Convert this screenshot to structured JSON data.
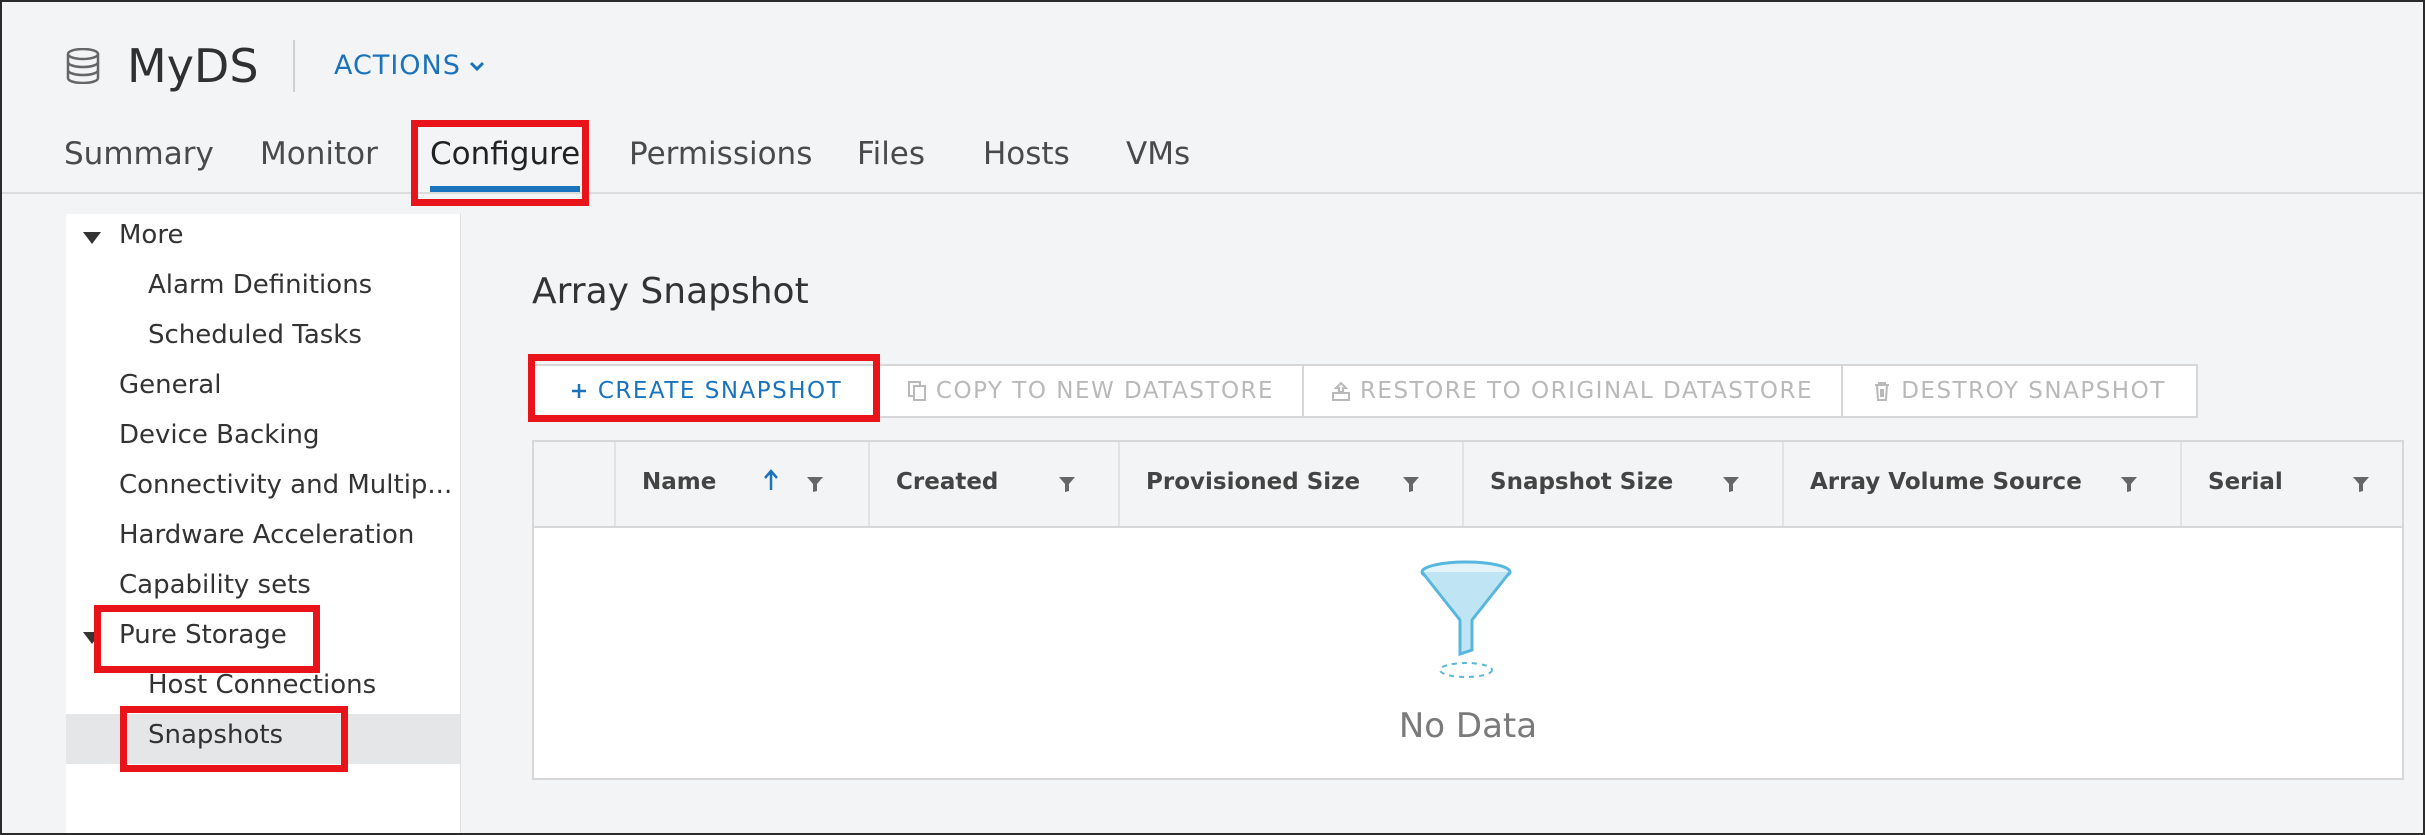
{
  "header": {
    "object_icon": "datastore-icon",
    "title": "MyDS",
    "actions_label": "ACTIONS",
    "actions_icon": "chevron-down-icon"
  },
  "tabs": [
    {
      "label": "Summary"
    },
    {
      "label": "Monitor"
    },
    {
      "label": "Configure",
      "active": true
    },
    {
      "label": "Permissions"
    },
    {
      "label": "Files"
    },
    {
      "label": "Hosts"
    },
    {
      "label": "VMs"
    }
  ],
  "sidebar": {
    "items": [
      {
        "label": "More",
        "expanded": true
      },
      {
        "label": "Alarm Definitions"
      },
      {
        "label": "Scheduled Tasks"
      },
      {
        "label": "General"
      },
      {
        "label": "Device Backing"
      },
      {
        "label": "Connectivity and Multip..."
      },
      {
        "label": "Hardware Acceleration"
      },
      {
        "label": "Capability sets"
      },
      {
        "label": "Pure Storage",
        "expanded": true
      },
      {
        "label": "Host Connections"
      },
      {
        "label": "Snapshots",
        "selected": true
      }
    ]
  },
  "main": {
    "title": "Array Snapshot",
    "toolbar": [
      {
        "label": "CREATE SNAPSHOT",
        "icon": "plus-icon",
        "enabled": true
      },
      {
        "label": "COPY TO NEW DATASTORE",
        "icon": "copy-icon",
        "enabled": false
      },
      {
        "label": "RESTORE TO ORIGINAL DATASTORE",
        "icon": "restore-icon",
        "enabled": false
      },
      {
        "label": "DESTROY SNAPSHOT",
        "icon": "trash-icon",
        "enabled": false
      }
    ],
    "grid": {
      "columns": [
        {
          "label": "Name",
          "sorted": "ascending"
        },
        {
          "label": "Created"
        },
        {
          "label": "Provisioned Size"
        },
        {
          "label": "Snapshot Size"
        },
        {
          "label": "Array Volume Source"
        },
        {
          "label": "Serial"
        }
      ],
      "rows": [],
      "empty_icon": "funnel-icon",
      "empty_text": "No Data"
    }
  },
  "colors": {
    "accent": "#1a73bd",
    "highlight": "#e8141a",
    "disabled_text": "#b9b9b9"
  }
}
